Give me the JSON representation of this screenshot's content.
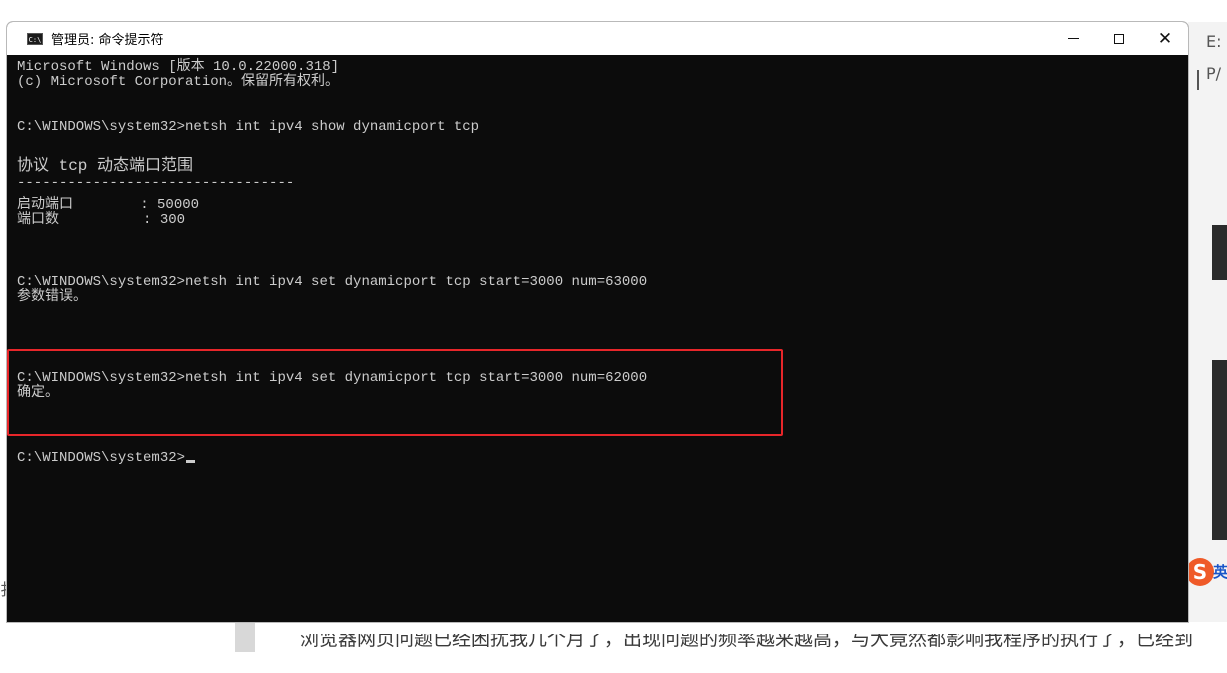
{
  "window": {
    "title": "管理员: 命令提示符",
    "icon": "cmd-icon",
    "icon_text": "C:\\",
    "controls": {
      "minimize": "minimize-icon",
      "maximize": "maximize-icon",
      "close": "close-icon"
    }
  },
  "console": {
    "lines": [
      "Microsoft Windows [版本 10.0.22000.318]",
      "(c) Microsoft Corporation。保留所有权利。",
      "",
      "C:\\WINDOWS\\system32>netsh int ipv4 show dynamicport tcp",
      "",
      "协议 tcp 动态端口范围",
      "---------------------------------",
      "启动端口        : 50000",
      "端口数          : 300",
      "",
      "",
      "C:\\WINDOWS\\system32>netsh int ipv4 set dynamicport tcp start=3000 num=63000",
      "参数错误。",
      "",
      "",
      "",
      "C:\\WINDOWS\\system32>netsh int ipv4 set dynamicport tcp start=3000 num=62000",
      "确定。",
      "",
      "C:\\WINDOWS\\system32>"
    ]
  },
  "annotation": {
    "color": "#e8262a"
  },
  "background": {
    "ime_badge": "S",
    "ime_label": "英",
    "bottom_text": "浏览器网页问题已经困扰我几个月了，出现问题的频率越来越高，与大竟然都影响我程序的执行了，已经到",
    "side_fragment": "扌",
    "right_chars": [
      "E:",
      "P/"
    ]
  },
  "colors": {
    "console_bg": "#0c0c0c",
    "console_fg": "#cccccc",
    "titlebar_bg": "#ffffff"
  }
}
